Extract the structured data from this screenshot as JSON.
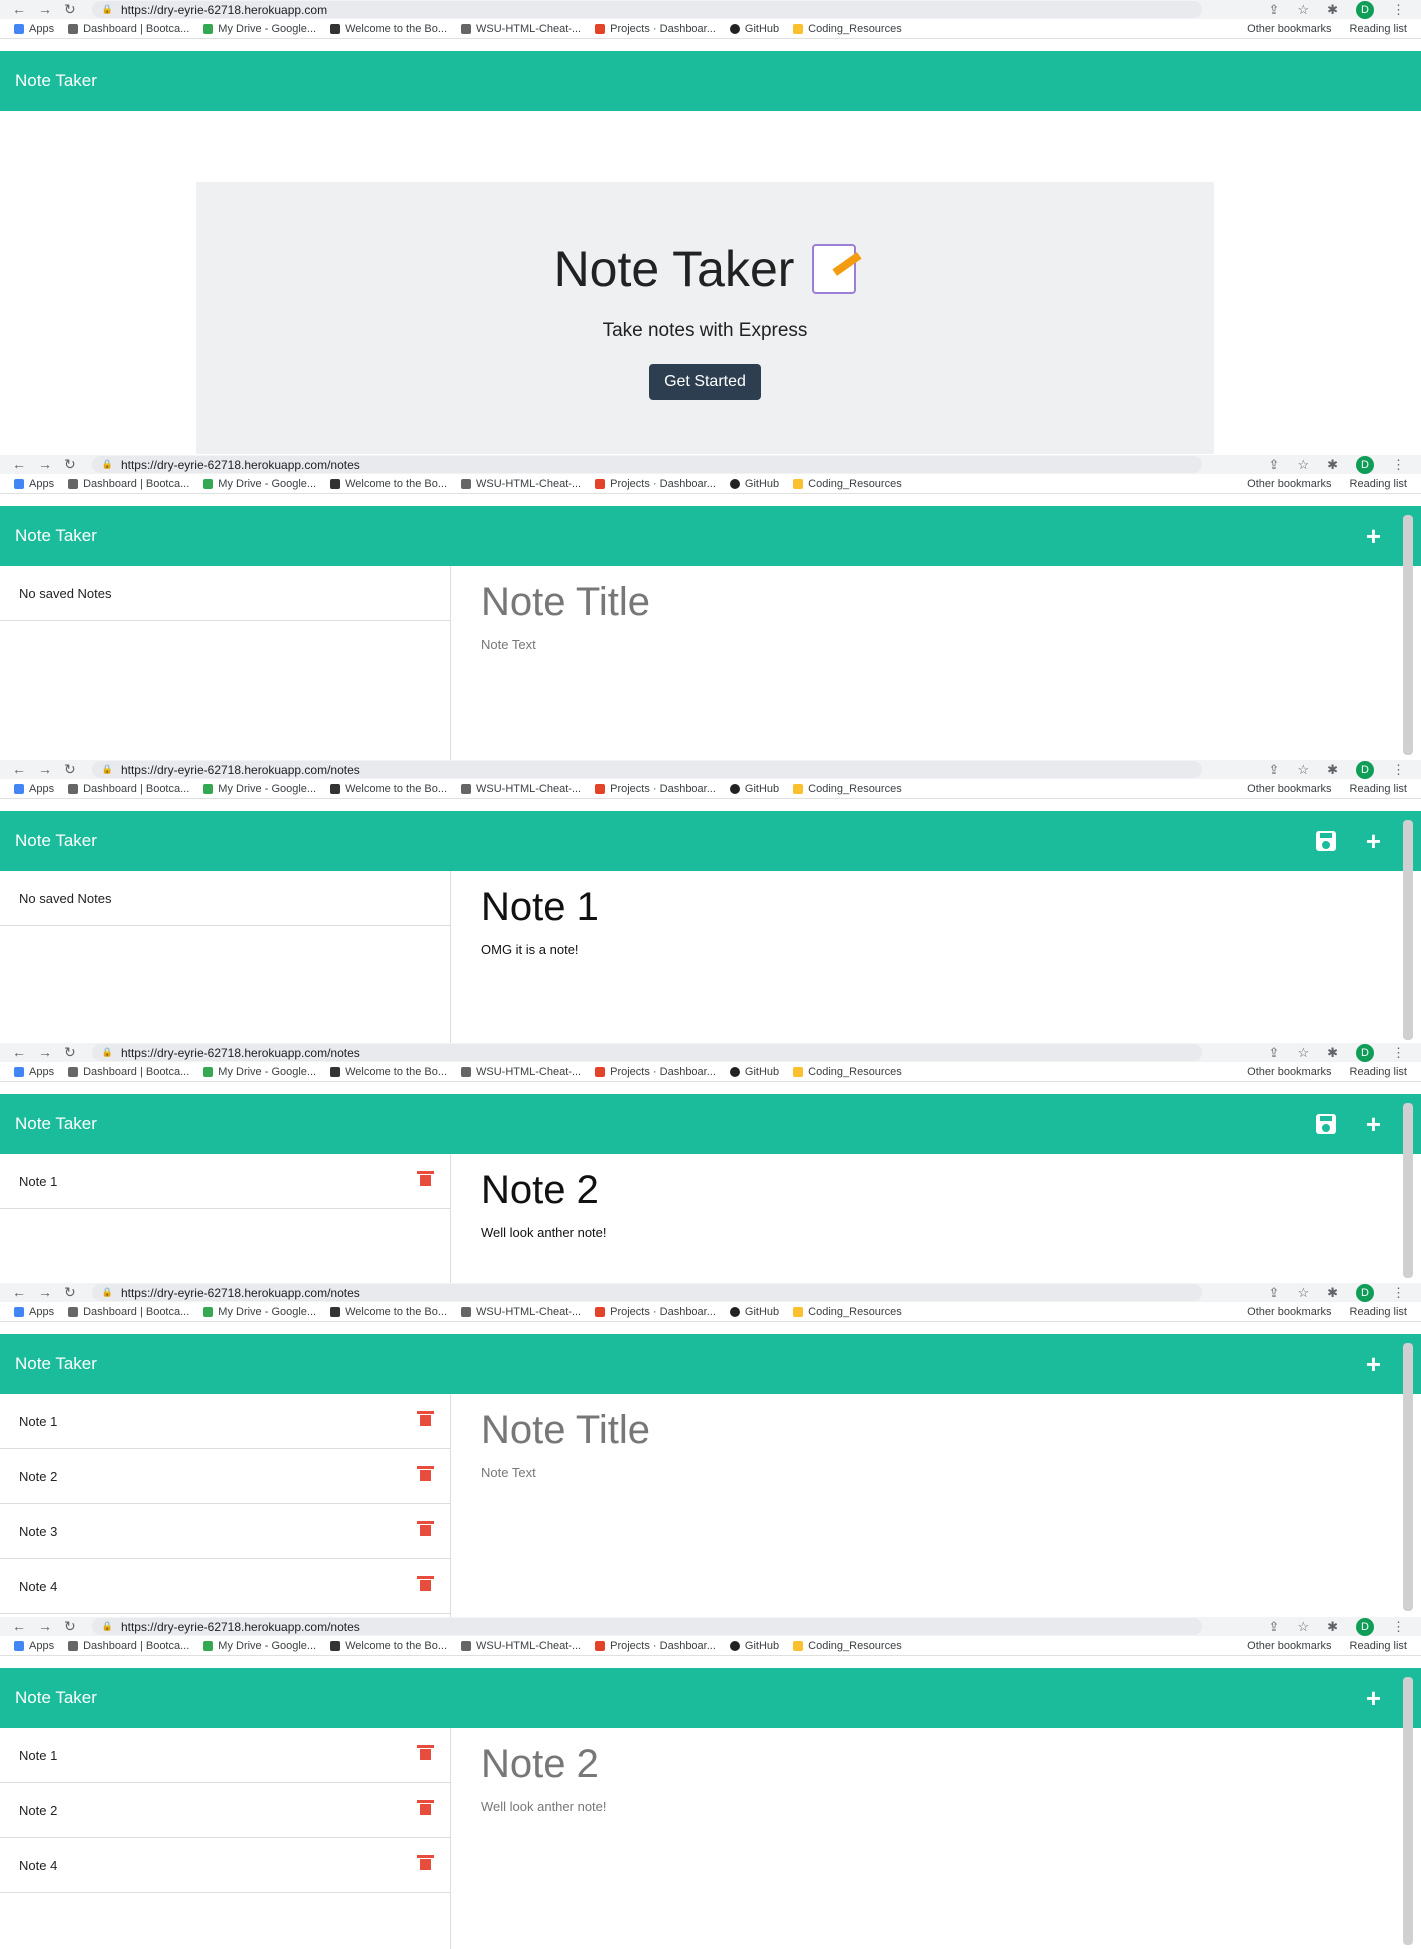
{
  "browser": {
    "url_home": "https://dry-eyrie-62718.herokuapp.com",
    "url_notes": "https://dry-eyrie-62718.herokuapp.com/notes",
    "avatar_letter": "D",
    "bookmarks": [
      {
        "label": "Apps",
        "color": "#4285f4"
      },
      {
        "label": "Dashboard | Bootca...",
        "color": "#666666"
      },
      {
        "label": "My Drive - Google...",
        "color": "#34a853"
      },
      {
        "label": "Welcome to the Bo...",
        "color": "#333333"
      },
      {
        "label": "WSU-HTML-Cheat-...",
        "color": "#666666"
      },
      {
        "label": "Projects · Dashboar...",
        "color": "#e24329"
      },
      {
        "label": "GitHub",
        "color": "#222222"
      },
      {
        "label": "Coding_Resources",
        "color": "#fbc02d"
      }
    ],
    "other_bookmarks": "Other bookmarks",
    "reading_list": "Reading list"
  },
  "app": {
    "title": "Note Taker",
    "landing": {
      "heading": "Note Taker",
      "subtitle": "Take notes with Express",
      "cta": "Get Started"
    },
    "empty_list": "No saved Notes",
    "title_placeholder": "Note Title",
    "text_placeholder": "Note Text",
    "add_symbol": "+",
    "trash_color": "#e74c3c",
    "brand_color": "#1abc9c"
  },
  "screens": {
    "s2": {
      "editor_title": "Note Title",
      "editor_text": "Note Text"
    },
    "s3": {
      "editor_title": "Note 1",
      "editor_text": "OMG it is a note!"
    },
    "s4": {
      "notes": [
        "Note 1"
      ],
      "editor_title": "Note 2",
      "editor_text": "Well look anther note!"
    },
    "s5": {
      "notes": [
        "Note 1",
        "Note 2",
        "Note 3",
        "Note 4"
      ],
      "editor_title": "Note Title",
      "editor_text": "Note Text"
    },
    "s6": {
      "notes": [
        "Note 1",
        "Note 2",
        "Note 4"
      ],
      "editor_title": "Note 2",
      "editor_text": "Well look anther note!"
    }
  }
}
